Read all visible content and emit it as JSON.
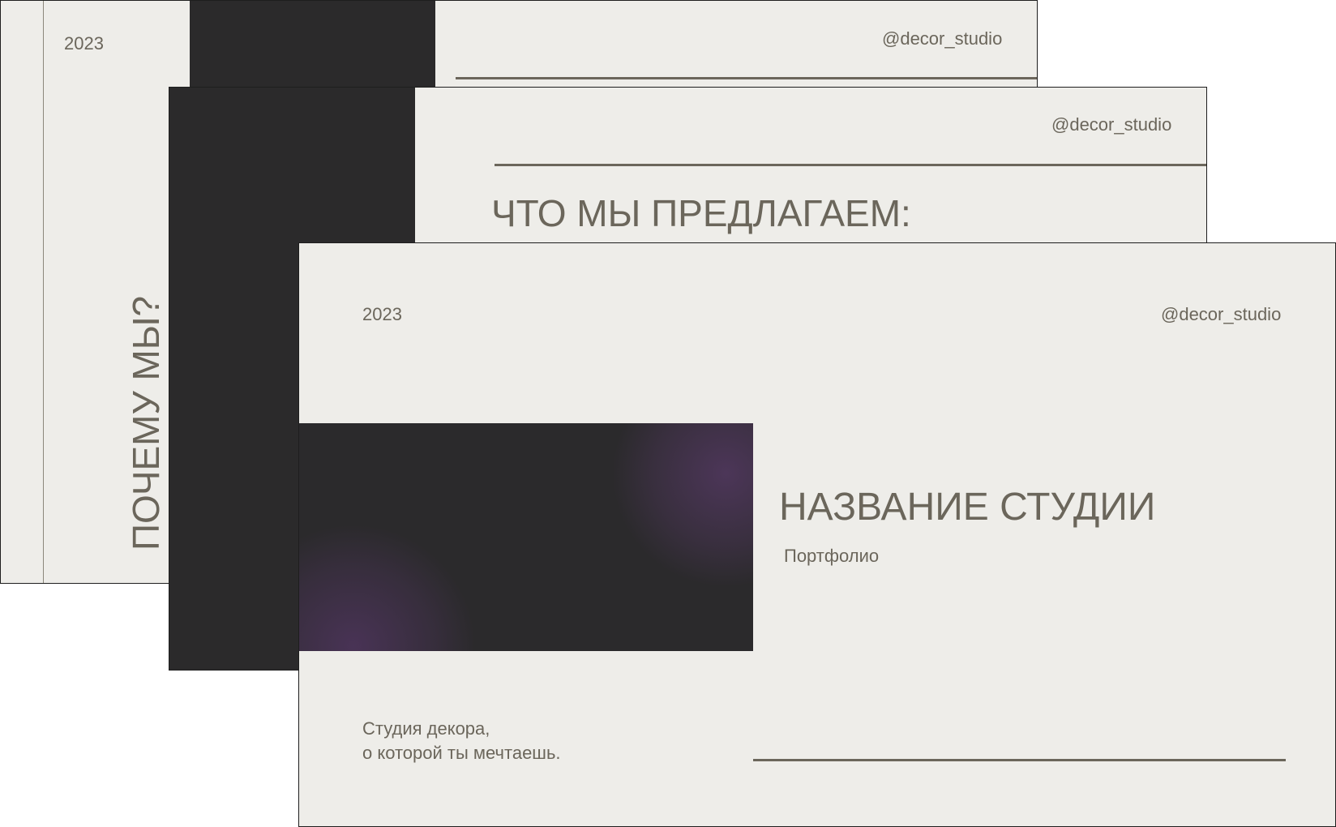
{
  "theme": {
    "background": "#eeede9",
    "dark_panel": "#2b2a2b",
    "text": "#6b665b",
    "line": "#6b665b",
    "accent_glow": "#4f3a5e"
  },
  "slides": [
    {
      "year": "2023",
      "handle": "@decor_studio",
      "title": "ПОЧЕМУ МЫ?"
    },
    {
      "handle": "@decor_studio",
      "title": "ЧТО МЫ ПРЕДЛАГАЕМ:"
    },
    {
      "year": "2023",
      "handle": "@decor_studio",
      "studio_name": "НАЗВАНИЕ СТУДИИ",
      "subtitle": "Портфолио",
      "tagline_line1": "Студия декора,",
      "tagline_line2": "о которой ты мечтаешь."
    }
  ]
}
